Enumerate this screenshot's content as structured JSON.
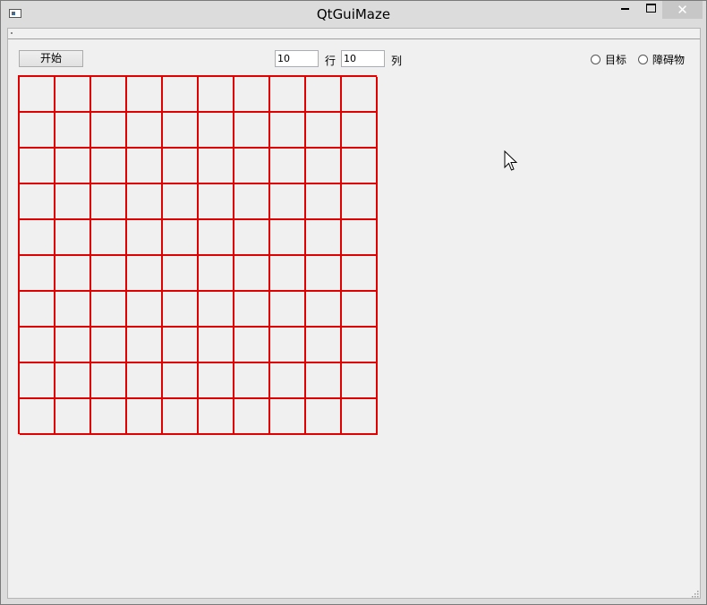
{
  "window": {
    "title": "QtGuiMaze",
    "close_glyph": "✕"
  },
  "toolbar": {
    "start_label": "开始",
    "rows_value": "10",
    "rows_label": "行",
    "cols_value": "10",
    "cols_label": "列"
  },
  "mode_options": [
    {
      "label": "目标",
      "checked": false
    },
    {
      "label": "障碍物",
      "checked": false
    }
  ],
  "maze": {
    "rows": 10,
    "cols": 10,
    "line_color": "#e00000"
  },
  "icons": {
    "app": "app-window-icon",
    "minimize": "minimize-icon",
    "maximize": "maximize-icon",
    "close": "close-icon",
    "cursor": "mouse-pointer-icon",
    "size_grip": "size-grip-icon"
  }
}
